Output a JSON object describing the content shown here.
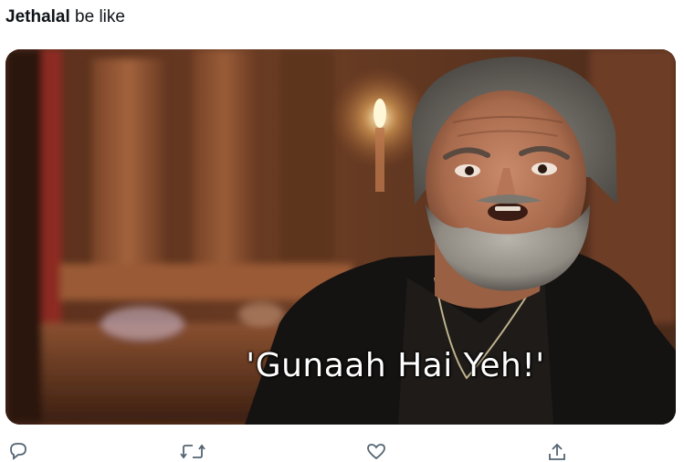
{
  "tweet": {
    "author": "Jethalal",
    "text": " be like"
  },
  "media": {
    "caption": "'Gunaah Hai Yeh!'",
    "description_icon": "movie-still"
  },
  "actions": {
    "reply_icon": "reply-icon",
    "retweet_icon": "retweet-icon",
    "like_icon": "heart-icon",
    "share_icon": "share-icon"
  },
  "colors": {
    "text": "#0f1419",
    "icon": "#536471",
    "caption": "#ffffff"
  }
}
